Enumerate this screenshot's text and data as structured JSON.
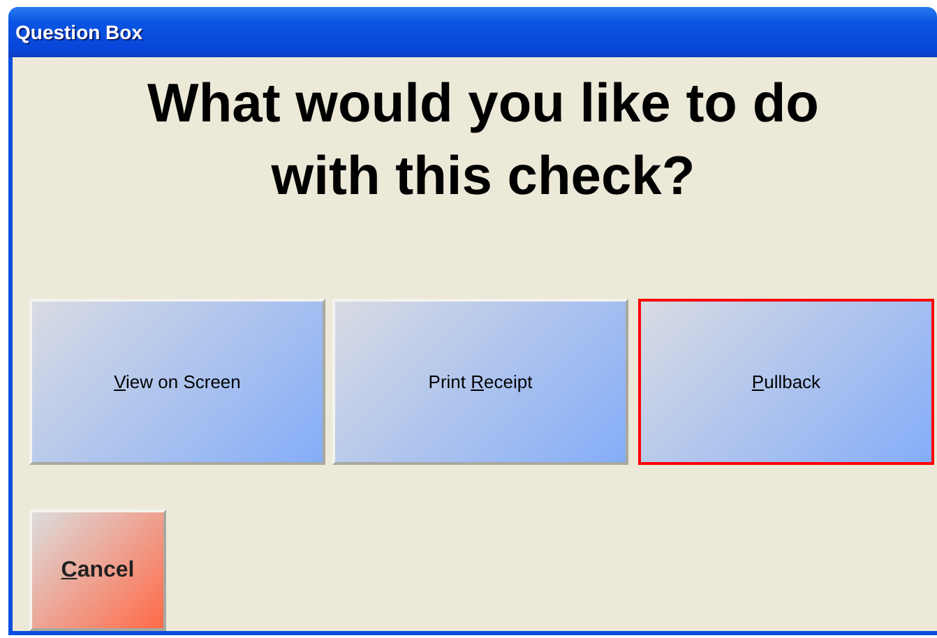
{
  "window": {
    "title": "Question Box"
  },
  "question": "What would you like to do with this check?",
  "choices": [
    {
      "key": "V",
      "after": "iew on Screen",
      "selected": false
    },
    {
      "before": "Print ",
      "key": "R",
      "after": "eceipt",
      "selected": false
    },
    {
      "key": "P",
      "after": "ullback",
      "selected": true
    }
  ],
  "cancel": {
    "key": "C",
    "after": "ancel"
  }
}
